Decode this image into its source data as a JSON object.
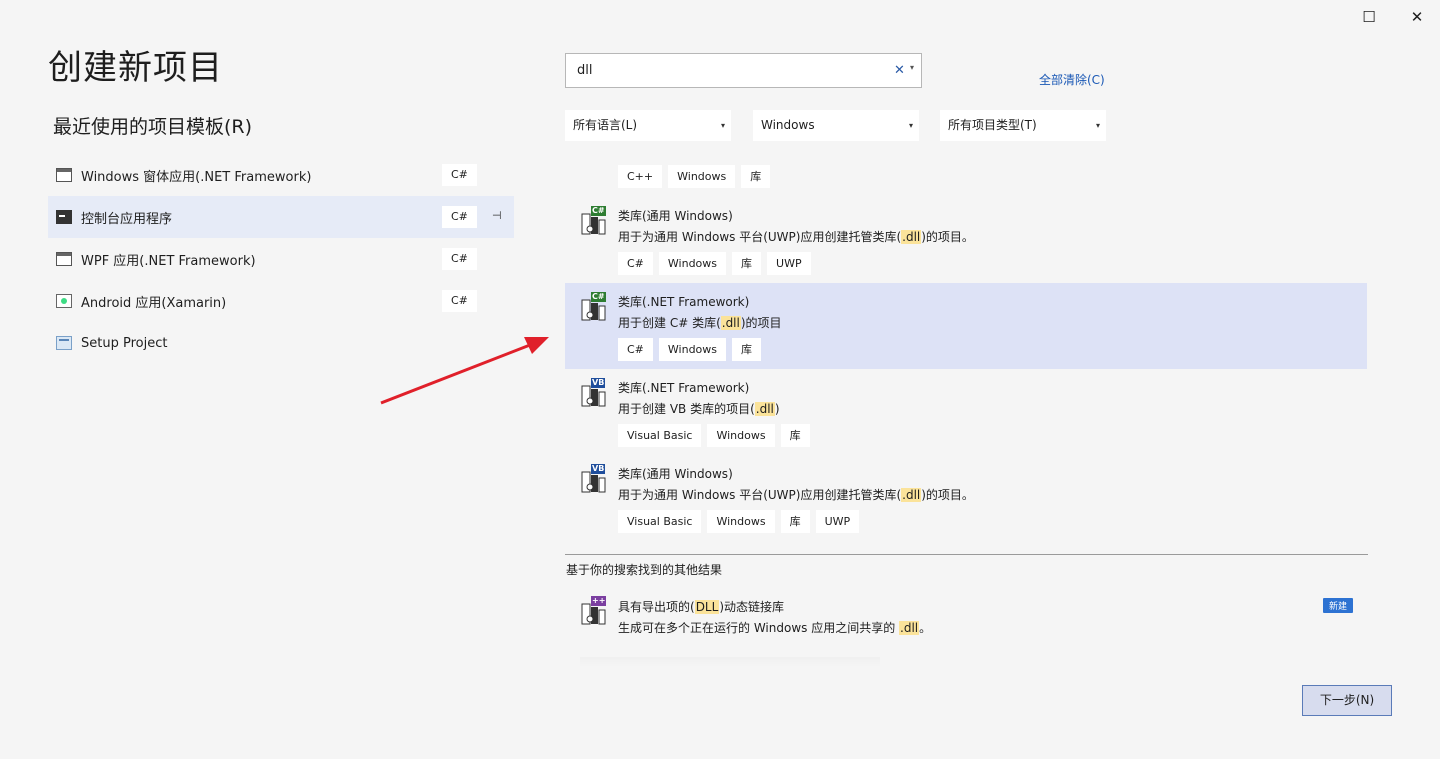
{
  "window": {
    "maximize_glyph": "☐",
    "close_glyph": "✕"
  },
  "page_title": "创建新项目",
  "recent": {
    "title": "最近使用的项目模板(R)",
    "items": [
      {
        "label": "Windows 窗体应用(.NET Framework)",
        "lang": "C#",
        "icon": "winforms-icon"
      },
      {
        "label": "控制台应用程序",
        "lang": "C#",
        "icon": "console-icon",
        "selected": true,
        "pin": "⊣"
      },
      {
        "label": "WPF 应用(.NET Framework)",
        "lang": "C#",
        "icon": "wpf-icon"
      },
      {
        "label": "Android 应用(Xamarin)",
        "lang": "C#",
        "icon": "android-icon"
      },
      {
        "label": "Setup Project",
        "lang": "",
        "icon": "setup-icon"
      }
    ]
  },
  "search": {
    "value": "dll",
    "clear_glyph": "✕",
    "dropdown_glyph": "▾"
  },
  "clear_all": "全部清除(C)",
  "filters": {
    "language": "所有语言(L)",
    "platform": "Windows",
    "project_type": "所有项目类型(T)",
    "caret": "▾"
  },
  "top_tags": [
    "C++",
    "Windows",
    "库"
  ],
  "templates": [
    {
      "title": "类库(通用 Windows)",
      "desc_before": "用于为通用 Windows 平台(UWP)应用创建托管类库(",
      "desc_highlight": ".dll",
      "desc_after": ")的项目。",
      "badge": "C#",
      "badge_color": "#2e7d32",
      "tags": [
        "C#",
        "Windows",
        "库",
        "UWP"
      ]
    },
    {
      "title": "类库(.NET Framework)",
      "desc_before": "用于创建 C# 类库(",
      "desc_highlight": ".dll",
      "desc_after": ")的项目",
      "badge": "C#",
      "badge_color": "#2e7d32",
      "tags": [
        "C#",
        "Windows",
        "库"
      ],
      "selected": true
    },
    {
      "title": "类库(.NET Framework)",
      "desc_before": "用于创建 VB 类库的项目(",
      "desc_highlight": ".dll",
      "desc_after": ")",
      "badge": "VB",
      "badge_color": "#1f4e9c",
      "tags": [
        "Visual Basic",
        "Windows",
        "库"
      ]
    },
    {
      "title": "类库(通用 Windows)",
      "desc_before": "用于为通用 Windows 平台(UWP)应用创建托管类库(",
      "desc_highlight": ".dll",
      "desc_after": ")的项目。",
      "badge": "VB",
      "badge_color": "#1f4e9c",
      "tags": [
        "Visual Basic",
        "Windows",
        "库",
        "UWP"
      ]
    }
  ],
  "other_results": {
    "label": "基于你的搜索找到的其他结果",
    "item": {
      "title_before": "具有导出项的(",
      "title_highlight": "DLL",
      "title_after": ")动态链接库",
      "desc_before": "生成可在多个正在运行的 Windows 应用之间共享的 ",
      "desc_highlight": ".dll",
      "desc_after": "。",
      "badge": "++",
      "badge_color": "#7b3fa0",
      "new_badge": "新建"
    }
  },
  "next_button": "下一步(N)",
  "annotation_color": "#e0202a"
}
